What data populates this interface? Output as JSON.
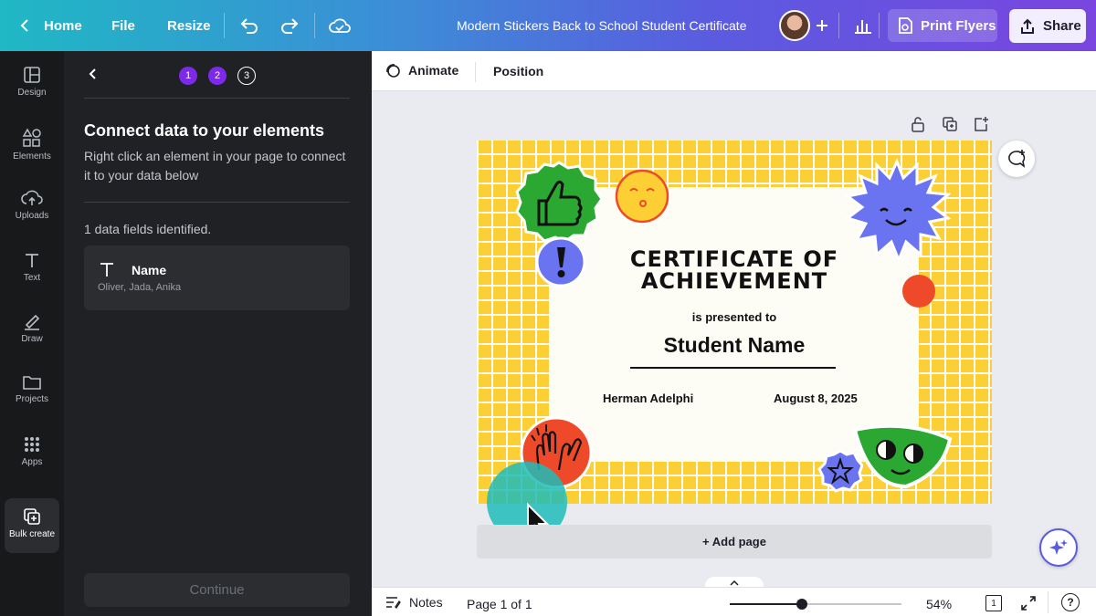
{
  "topbar": {
    "home_label": "Home",
    "file_label": "File",
    "resize_label": "Resize",
    "doc_title": "Modern Stickers Back to School Student Certificate",
    "print_label": "Print Flyers",
    "share_label": "Share"
  },
  "rail": {
    "items": [
      {
        "label": "Design"
      },
      {
        "label": "Elements"
      },
      {
        "label": "Uploads"
      },
      {
        "label": "Text"
      },
      {
        "label": "Draw"
      },
      {
        "label": "Projects"
      },
      {
        "label": "Apps"
      },
      {
        "label": "Bulk create"
      }
    ]
  },
  "panel": {
    "steps": [
      "1",
      "2",
      "3"
    ],
    "heading": "Connect data to your elements",
    "description_line1": "Right click an element in your page to connect",
    "description_line2": "it to your data below",
    "fields_identified": "1 data fields identified.",
    "field": {
      "name": "Name",
      "values": "Oliver, Jada, Anika"
    },
    "continue_label": "Continue"
  },
  "toolbar": {
    "animate_label": "Animate",
    "position_label": "Position"
  },
  "certificate": {
    "title_line1": "CERTIFICATE OF",
    "title_line2": "ACHIEVEMENT",
    "presented": "is presented to",
    "student_name": "Student Name",
    "signer": "Herman Adelphi",
    "date": "August 8, 2025"
  },
  "canvas": {
    "add_page_label": "+ Add page"
  },
  "bottom": {
    "notes_label": "Notes",
    "page_label": "Page 1 of 1",
    "zoom_label": "54%",
    "zoom_fraction": 0.42,
    "page_count": "1",
    "help_label": "?"
  },
  "colors": {
    "accent_purple": "#7d2ae8",
    "cert_yellow": "#fcd034",
    "sticker_green": "#2aa832",
    "sticker_blue": "#6b74f0",
    "sticker_red": "#ee4a2a",
    "cursor_teal": "#1fbcb8"
  }
}
